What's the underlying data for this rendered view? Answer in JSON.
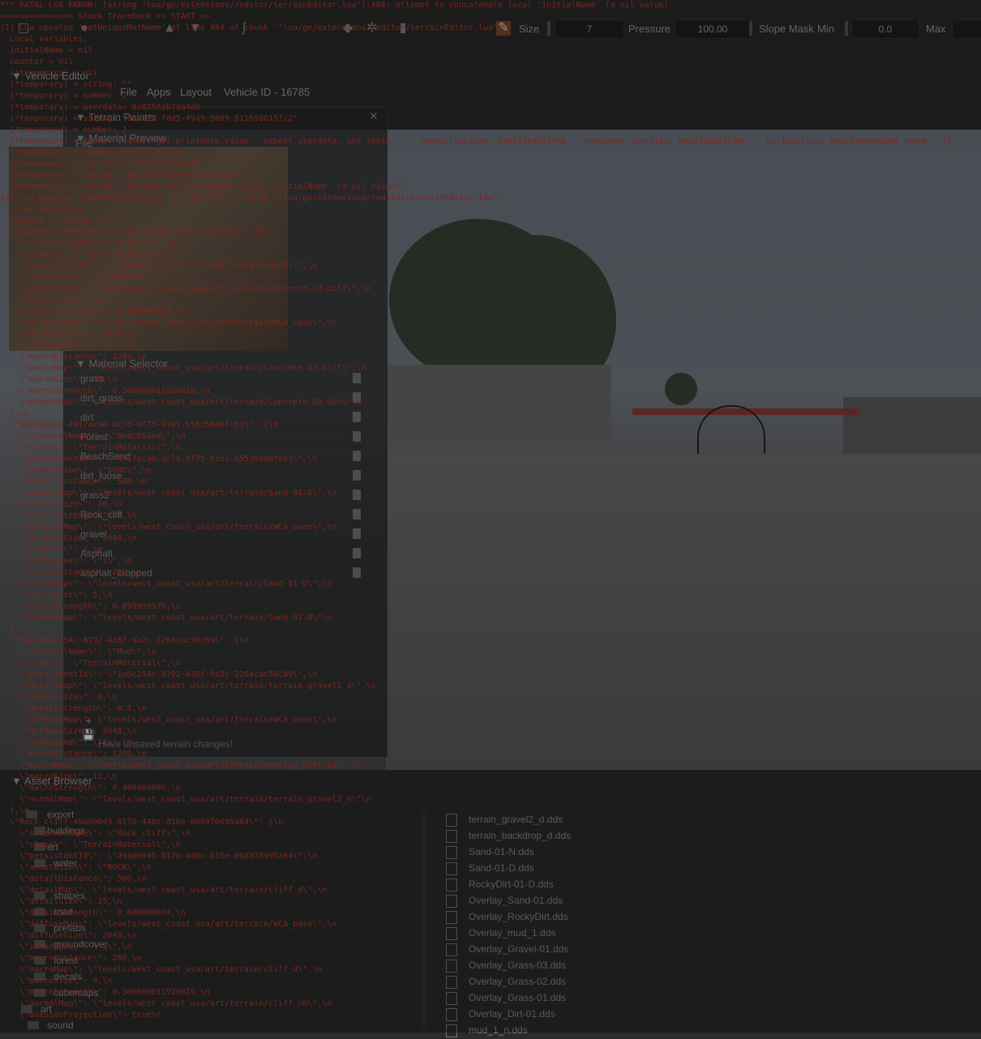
{
  "toolbar": {
    "size_label": "Size",
    "size_value": "7",
    "pressure_label": "Pressure",
    "pressure_value": "100.00",
    "slope_mask_label": "Slope Mask",
    "min_label": "Min",
    "min_value": "0.0",
    "max_label": "Max"
  },
  "vehicle_editor": {
    "header": "Vehicle Editor",
    "menu": [
      "File",
      "Apps",
      "Layout",
      "Vehicle ID - 16785"
    ]
  },
  "terrain_painter": {
    "title": "Terrain Painter",
    "file_label": "File",
    "material_preview_label": "Material Preview",
    "material_selector_label": "Material Selector",
    "materials": [
      "grass",
      "dirt_grass",
      "dirt",
      "Forest",
      "BeachSand",
      "dirt_loose",
      "grass2",
      "Rock_cliff",
      "gravel",
      "Asphalt",
      "asphalt_cropped"
    ],
    "unsaved_message": "Have unsaved terrain changes!",
    "close_icon": "close-icon"
  },
  "asset_browser": {
    "header": "Asset Browser",
    "folders": [
      "export",
      "buildings",
      "art",
      "water",
      "shapes",
      "road",
      "prefabs",
      "groundcover",
      "forest",
      "decals",
      "cubemaps",
      "art",
      "sound"
    ],
    "files": [
      "terrain_gravel2_d.dds",
      "terrain_backdrop_d.dds",
      "Sand-01-N.dds",
      "Sand-01-D.dds",
      "RockyDirt-01-D.dds",
      "Overlay_Sand-01.dds",
      "Overlay_RockyDirt.dds",
      "Overlay_mud_1.dds",
      "Overlay_Gravel-01.dds",
      "Overlay_Grass-03.dds",
      "Overlay_Grass-02.dds",
      "Overlay_Grass-01.dds",
      "Overlay_Dirt-01.dds",
      "mud_1_n.dds"
    ]
  },
  "lua_log": [
    "*** FATAL LUA ERROR: [string \"lua/ge/extensions//editor/terrainEditor.lua\"]:484: attempt to concatenate local 'initialName' (a nil value)",
    "=============== Stack Traceback >> START >>",
    "(1) Lua upvalue 'getUniqueMatName' at line 484 of chunk '\"lua/ge/extensions//editor/terrainEditor.lua\"'",
    "  Local variables:",
    "  initialName = nil",
    "  counter = nil",
    "  (*temporary) = nil",
    "  (*temporary) = string: \"\"",
    "  (*temporary) = number: 1",
    "  (*temporary) = userdata: 0x8258ab7da4d0",
    "  (*temporary) = string: \"d87ef2-f0d5-4949-9809-811698615fc2\"",
    "  (*temporary) = number: 2",
    "  (*temporary) = table: {cannot get printable value: 'expect userdata, got table' : __index:function: 0x0213b0237f88, __newindex:function: 0x0213b0237d8c, __gc:function: 0x0213bead01e0 (more...)}",
    "  (*temporary) = number: 0.953125(333)",
    "  (*temporary) = userdata: 0x8258ab7da4d0",
    "  (*temporary) = string: \"getInCreatePersistentId\"",
    "  (*temporary) = string: \"attempt to concatenate local 'initialName' (a nil value)\"",
    "(2) Lua upvalue 'updateMatLibrary' at line 516 of chunk '\"lua/ge/extensions//editor/terrainEditor.lua\"'",
    "  Local variables:",
    "  content = string: \"{\\n",
    "  \\\"Asphalt-a5665e9f-7729-477f-8857-92297c3dc08c\\\": {\\n",
    "    \\\"internalName\\\": \\\"Asphalt\\\",\\n",
    "    \\\"class\\\": \\\"TerrainMaterial\\\",\\n",
    "    \\\"persistentId\\\": \\\"a5665e9f-7729-477f-8857-92297c3dc08c\\\",\\n",
    "    \\\"annotation\\\": \\\"ASPHALT\\\",\\n",
    "    \\\"detailMap\\\": \\\"levels/west_coast_usa/art/terrain/Concrete-03-diff\\\",\\n",
    "    \\\"detailSize\\\": 4,\\n",
    "    \\\"detailStrength\\\": 0.800000024,\\n",
    "    \\\"diffuseMap\\\": \\\"levels/west_coast_usa/art/terrain/WCA_base\\\",\\n",
    "    \\\"diffuseSize\\\": 2048,\\n",
    "    \\\"isManaged\\\": \\\"1\\\",\\n",
    "    \\\"macroDistance\\\": 1200,\\n",
    "    \\\"macroMap\\\": \\\"levels/west_coast_usa/art/terrain/Concrete-03-diff\\\",\\n",
    "    \\\"macroSize\\\": 30,\\n",
    "    \\\"macroStrength\\\": 0.300000011920929,\\n",
    "    \\\"normalMap\\\": \\\"levels/west_coast_usa/art/terrain/Concrete-03-ddn\\\"\\n",
    "  },\\n",
    "  \\\"BeachSand-4917aca0-dc7d-4f75-91e1-b55356a6fc63\\\": {\\n",
    "    \\\"internalName\\\": \\\"BeachSand\\\",\\n",
    "    \\\"class\\\": \\\"TerrainMaterial\\\",\\n",
    "    \\\"persistentId\\\": \\\"4917aca0-dc7d-4f75-91e1-b55356a6fc63\\\",\\n",
    "    \\\"annotation\\\": \\\"SAND\\\",\\n",
    "    \\\"detailDistance\\\": 500,\\n",
    "    \\\"detailMap\\\": \\\"levels/west_coast_usa/art/terrain/Sand-01-D\\\",\\n",
    "    \\\"detailSize\\\": 20,\\n",
    "    \\\"detailStrength\\\": 1,\\n",
    "    \\\"diffuseMap\\\": \\\"levels/west_coast_usa/art/terrain/WCA_base\\\",\\n",
    "    \\\"diffuseSize\\\": 2048,\\n",
    "    \\\"enabled\\\": 1,\\n",
    "    \\\"isManaged\\\": \\\"1\\\",\\n",
    "    \\\"macroDistance\\\": 200,\\n",
    "    \\\"macroMap\\\": \\\"levels/west_coast_usa/art/terrain/Sand-01-D\\\",\\n",
    "    \\\"macroSize\\\": 5,\\n",
    "    \\\"macroStrength\\\": 0.899999976,\\n",
    "    \\\"normalMap\\\": \\\"levels/west_coast_usa/art/terrain/Sand-01-N\\\"\\n",
    "  },\\n",
    "  \\\"Mud-1e6c254c-8792-438f-9a2c-2264cac59c89\\\": {\\n",
    "    \\\"internalName\\\": \\\"Mud\\\",\\n",
    "    \\\"class\\\": \\\"TerrainMaterial\\\",\\n",
    "    \\\"persistentId\\\": \\\"1e6c254c-8792-438f-9a2c-2264cac59c89\\\",\\n",
    "    \\\"detailMap\\\": \\\"levels/west_coast_usa/art/terrain/terrain_gravel2_d\\\",\\n",
    "    \\\"detailSize\\\": 6,\\n",
    "    \\\"detailStrength\\\": 0.5,\\n",
    "    \\\"diffuseMap\\\": \\\"levels/west_coast_usa/art/terrain/WCA_base\\\",\\n",
    "    \\\"diffuseSize\\\": 2048,\\n",
    "    \\\"isManaged\\\": \\\"1\\\",\\n",
    "    \\\"macroDistance\\\": 1200,\\n",
    "    \\\"macroMap\\\": \\\"levels/west_coast_usa/art/terrain/Overlay_Dirt-01\\\",\\n",
    "    \\\"macroSize\\\": 13,\\n",
    "    \\\"macroStrength\\\": 0.400000006,\\n",
    "    \\\"normalMap\\\": \\\"levels/west_coast_usa/art/terrain/terrain_gravel2_n\\\"\\n",
    "  },\\n",
    "  \\\"Rock_cliff-49ad9045-8176-44bc-816e-068970495a84\\\": {\\n",
    "    \\\"internalName\\\": \\\"Rock_cliff\\\",\\n",
    "    \\\"class\\\": \\\"TerrainMaterial\\\",\\n",
    "    \\\"persistentId\\\": \\\"49ad9045-8176-44bc-816e-068970495a84\\\",\\n",
    "    \\\"annotation\\\": \\\"ROCK\\\",\\n",
    "    \\\"detailDistance\\\": 500,\\n",
    "    \\\"detailMap\\\": \\\"levels/west_coast_usa/art/terrain/cliff_d\\\",\\n",
    "    \\\"detailSize\\\": 25,\\n",
    "    \\\"detailStrength\\\": 0.600000024,\\n",
    "    \\\"diffuseMap\\\": \\\"levels/west_coast_usa/art/terrain/WCA_base\\\",\\n",
    "    \\\"diffuseSize\\\": 2048,\\n",
    "    \\\"isManaged\\\": \\\"1\\\",\\n",
    "    \\\"macroDistance\\\": 200,\\n",
    "    \\\"macroMap\\\": \\\"levels/west_coast_usa/art/terrain/cliff_d\\\",\\n",
    "    \\\"macroSize\\\": 9,\\n",
    "    \\\"macroStrength\\\": 0.300000011920929,\\n",
    "    \\\"normalMap\\\": \\\"levels/west_coast_usa/art/terrain/cliff_nb\\\",\\n",
    "    \\\"useSideProjection\\\": true\\n"
  ]
}
